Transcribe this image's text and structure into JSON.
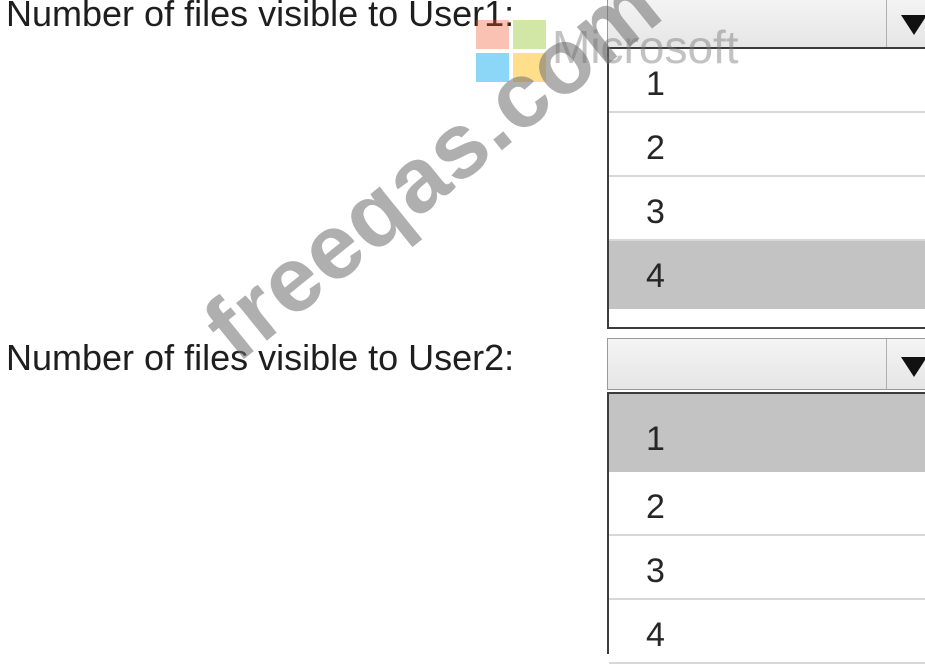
{
  "questions": [
    {
      "label": "Number of files visible to User1:",
      "options": [
        "1",
        "2",
        "3",
        "4"
      ],
      "selected": "4"
    },
    {
      "label": "Number of files visible to User2:",
      "options": [
        "1",
        "2",
        "3",
        "4"
      ],
      "selected": "1"
    }
  ],
  "watermark": {
    "text": "freeqas.com",
    "logo_text": "Microsoft"
  }
}
